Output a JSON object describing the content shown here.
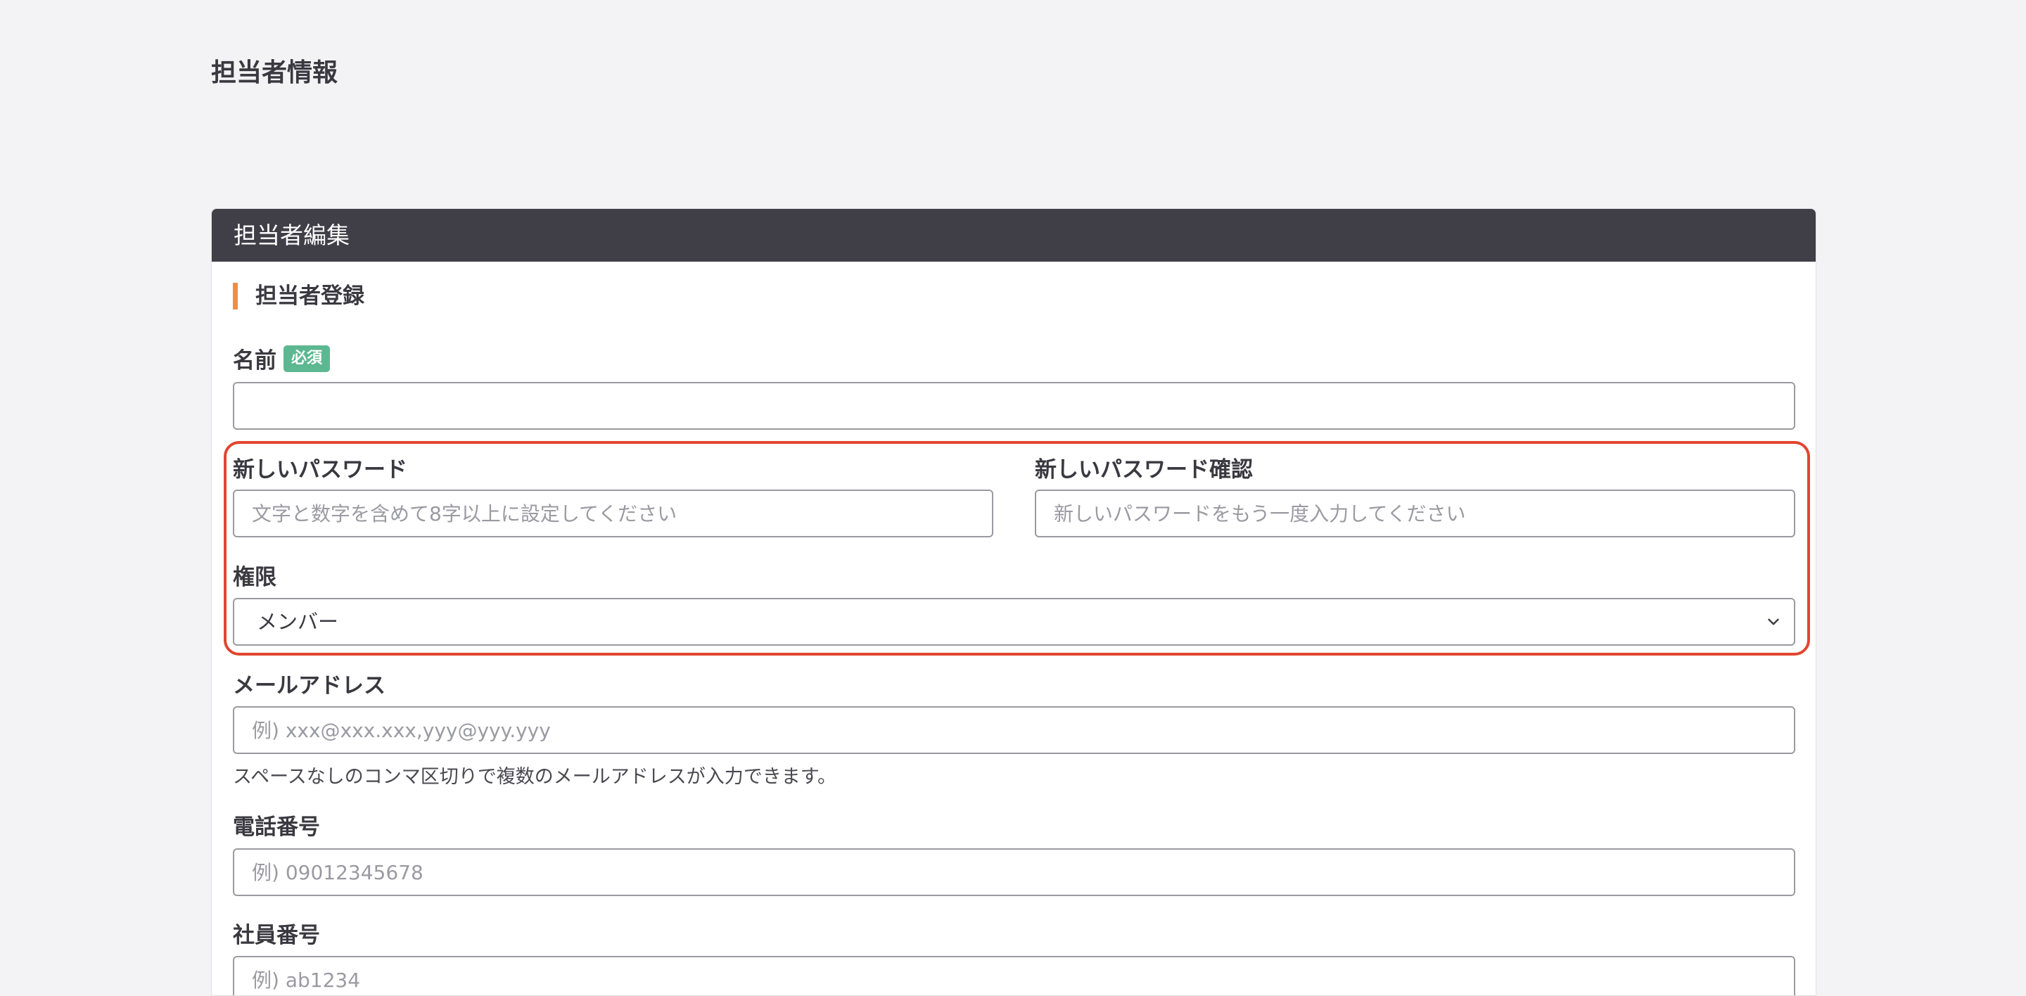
{
  "page": {
    "title": "担当者情報"
  },
  "card": {
    "header": "担当者編集",
    "section_title": "担当者登録"
  },
  "fields": {
    "name": {
      "label": "名前",
      "required_badge": "必須",
      "value": "",
      "placeholder": ""
    },
    "new_password": {
      "label": "新しいパスワード",
      "placeholder": "文字と数字を含めて8字以上に設定してください"
    },
    "new_password_confirm": {
      "label": "新しいパスワード確認",
      "placeholder": "新しいパスワードをもう一度入力してください"
    },
    "role": {
      "label": "権限",
      "selected": "メンバー"
    },
    "email": {
      "label": "メールアドレス",
      "placeholder": "例) xxx@xxx.xxx,yyy@yyy.yyy",
      "help": "スペースなしのコンマ区切りで複数のメールアドレスが入力できます。"
    },
    "phone": {
      "label": "電話番号",
      "placeholder": "例) 09012345678"
    },
    "employee_id": {
      "label": "社員番号",
      "placeholder": "例) ab1234"
    }
  },
  "colors": {
    "header_bg": "#403e47",
    "accent": "#ef8e43",
    "badge": "#5cb891",
    "highlight": "#e2452f"
  },
  "icons": {
    "select_arrow": "chevron-down-icon"
  }
}
